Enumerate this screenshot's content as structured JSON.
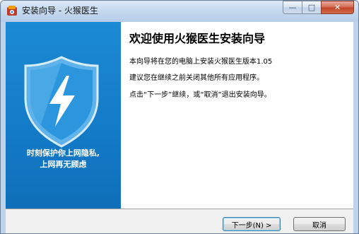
{
  "window": {
    "title": "安装向导 - 火猴医生",
    "min_glyph": "—",
    "max_glyph": "□",
    "close_glyph": "✕"
  },
  "sidebar": {
    "slogan_line1": "时刻保护你上网隐私,",
    "slogan_line2": "上网再无顾虑"
  },
  "content": {
    "heading": "欢迎使用火猴医生安装向导",
    "line1": "本向导将在您的电脑上安装火猴医生版本1.05",
    "line2": "建议您在继续之前关闭其他所有应用程序。",
    "line3": "点击“下一步”继续，或“取消”退出安装向导。"
  },
  "buttons": {
    "next_label": "下一步(N) >",
    "cancel_label": "取消"
  },
  "colors": {
    "sidebar_blue": "#1580cc",
    "shield_blue": "#2b95de"
  },
  "icons": {
    "app": "app-icon",
    "shield": "shield-lightning-icon"
  }
}
